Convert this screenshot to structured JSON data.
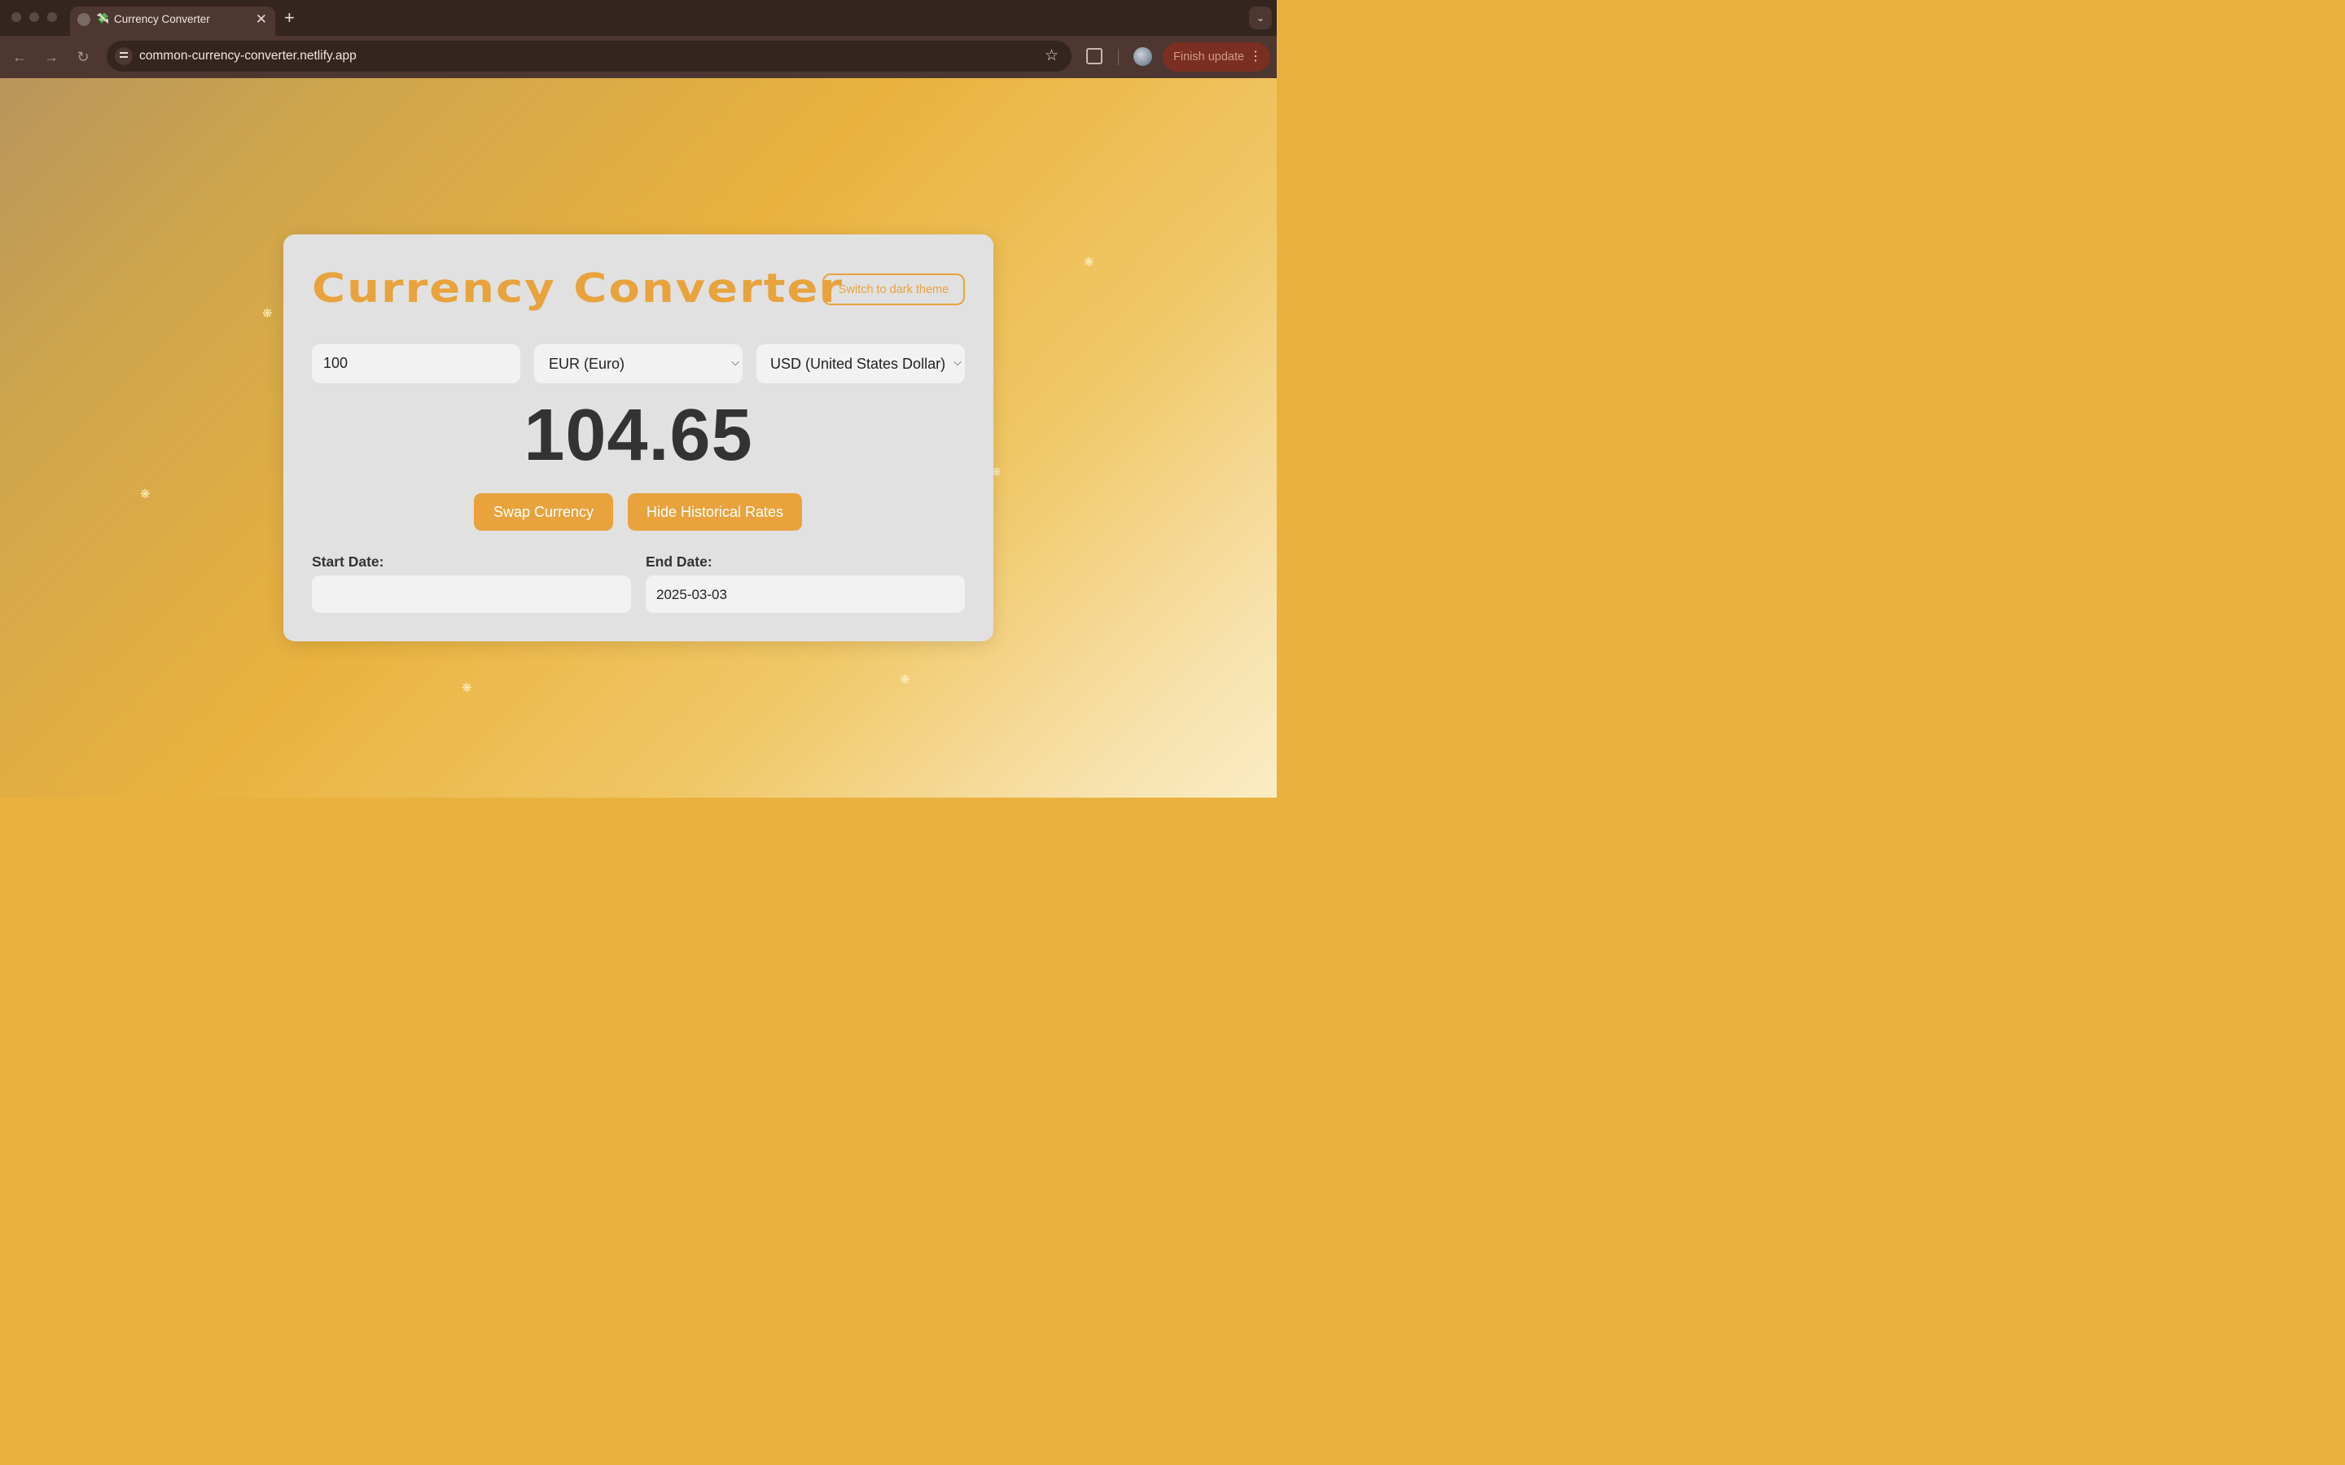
{
  "browser": {
    "tab_title": "Currency Converter",
    "tab_emoji": "💸",
    "new_tab_symbol": "+",
    "close_symbol": "✕",
    "url": "common-currency-converter.netlify.app",
    "finish_update_label": "Finish update",
    "icons": {
      "back": "←",
      "forward": "→",
      "reload": "↻",
      "bookmark": "☆",
      "menu": "⋮",
      "tab_search": "⌄"
    }
  },
  "app": {
    "title": "Currency Converter",
    "theme_toggle_label": "Switch to dark theme",
    "amount": "100",
    "from_currency": "EUR (Euro)",
    "to_currency": "USD (United States Dollar)",
    "result": "104.65",
    "swap_label": "Swap Currency",
    "historical_label": "Hide Historical Rates",
    "start_date_label": "Start Date:",
    "start_date_value": "",
    "end_date_label": "End Date:",
    "end_date_value": "2025-03-03"
  },
  "colors": {
    "accent": "#e8a33d",
    "card_bg": "#e1e1e1",
    "field_bg": "#f2f2f2",
    "text_dark": "#333333"
  }
}
